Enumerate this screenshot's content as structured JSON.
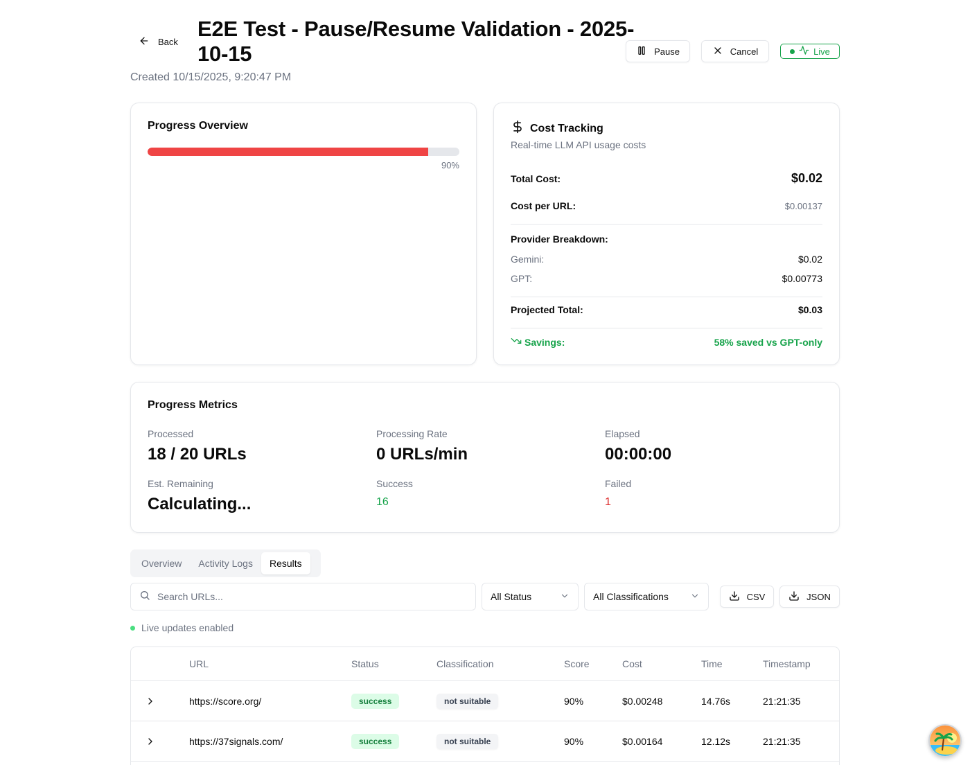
{
  "header": {
    "back_label": "Back",
    "title": "E2E Test - Pause/Resume Validation - 2025-10-15",
    "created": "Created 10/15/2025, 9:20:47 PM",
    "pause_label": "Pause",
    "cancel_label": "Cancel",
    "live_label": "Live"
  },
  "progress_overview": {
    "title": "Progress Overview",
    "percent_label": "90%",
    "percent_value": 0.9
  },
  "cost_tracking": {
    "title": "Cost Tracking",
    "subtitle": "Real-time LLM API usage costs",
    "total_cost_label": "Total Cost:",
    "total_cost_value": "$0.02",
    "cost_per_url_label": "Cost per URL:",
    "cost_per_url_value": "$0.00137",
    "provider_breakdown_label": "Provider Breakdown:",
    "providers": [
      {
        "name": "Gemini:",
        "value": "$0.02"
      },
      {
        "name": "GPT:",
        "value": "$0.00773"
      }
    ],
    "projected_total_label": "Projected Total:",
    "projected_total_value": "$0.03",
    "savings_label": "Savings:",
    "savings_value": "58% saved vs GPT-only"
  },
  "metrics": {
    "title": "Progress Metrics",
    "processed_label": "Processed",
    "processed_value": "18 / 20 URLs",
    "rate_label": "Processing Rate",
    "rate_value": "0 URLs/min",
    "elapsed_label": "Elapsed",
    "elapsed_value": "00:00:00",
    "remaining_label": "Est. Remaining",
    "remaining_value": "Calculating...",
    "success_label": "Success",
    "success_value": "16",
    "failed_label": "Failed",
    "failed_value": "1"
  },
  "tabs": [
    {
      "label": "Overview"
    },
    {
      "label": "Activity Logs"
    },
    {
      "label": "Results"
    }
  ],
  "filters": {
    "search_placeholder": "Search URLs...",
    "status_value": "All Status",
    "classification_value": "All Classifications",
    "csv_label": "CSV",
    "json_label": "JSON",
    "live_updates": "Live updates enabled"
  },
  "table": {
    "headers": {
      "url": "URL",
      "status": "Status",
      "classification": "Classification",
      "score": "Score",
      "cost": "Cost",
      "time": "Time",
      "timestamp": "Timestamp"
    },
    "rows": [
      {
        "url": "https://score.org/",
        "status": "success",
        "classification": "not suitable",
        "score": "90%",
        "cost": "$0.00248",
        "time": "14.76s",
        "timestamp": "21:21:35"
      },
      {
        "url": "https://37signals.com/",
        "status": "success",
        "classification": "not suitable",
        "score": "90%",
        "cost": "$0.00164",
        "time": "12.12s",
        "timestamp": "21:21:35"
      }
    ]
  },
  "colors": {
    "progress_fill": "#ef4444",
    "success": "#16a34a",
    "failed": "#dc2626"
  }
}
